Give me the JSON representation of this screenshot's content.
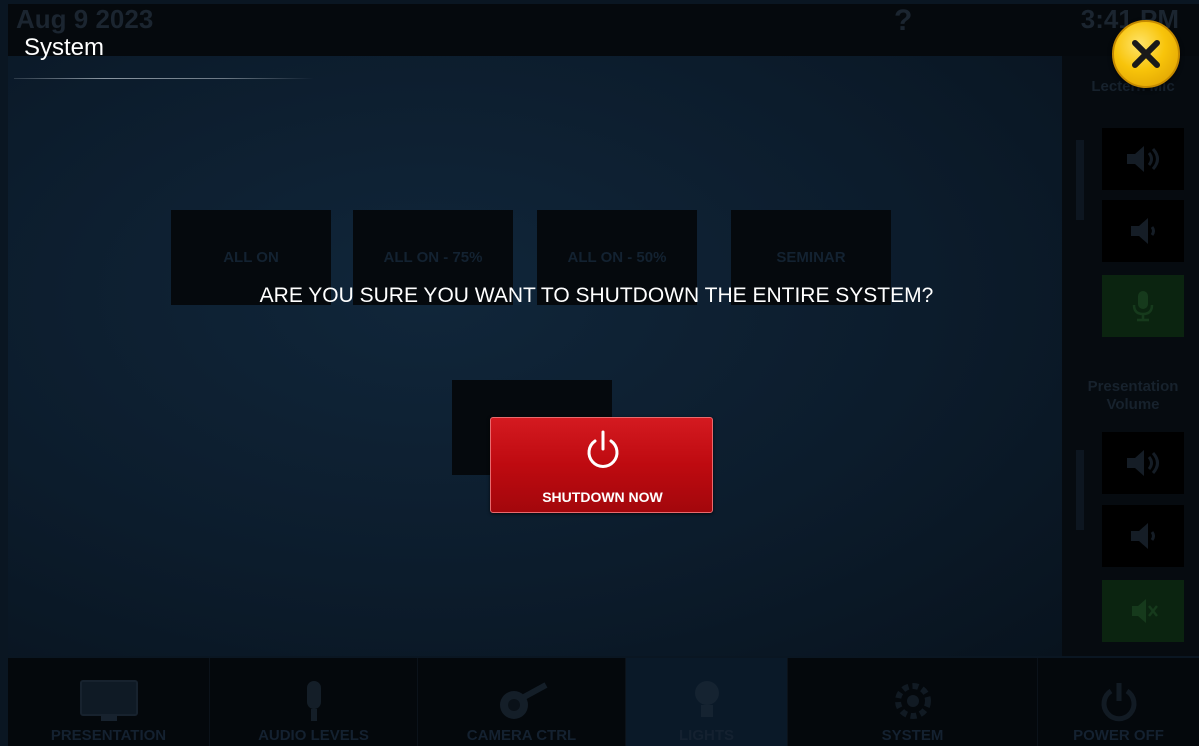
{
  "header": {
    "date": "Aug 9 2023",
    "time": "3:41 PM",
    "help_glyph": "?"
  },
  "modal": {
    "title": "System",
    "question": "ARE YOU SURE YOU WANT TO SHUTDOWN THE ENTIRE SYSTEM?",
    "shutdown_label": "SHUTDOWN NOW",
    "close_icon": "close-icon",
    "accent_yellow": "#f8c40a",
    "button_red": "#c40f15"
  },
  "presets": [
    "ALL ON",
    "ALL ON - 75%",
    "ALL ON - 50%",
    "SEMINAR"
  ],
  "right_panel": {
    "mic_label": "Lectern Mic",
    "presentation_label": "Presentation Volume"
  },
  "nav": [
    {
      "label": "PRESENTATION",
      "icon": "monitor-icon"
    },
    {
      "label": "AUDIO LEVELS",
      "icon": "microphone-icon"
    },
    {
      "label": "CAMERA CTRL",
      "icon": "camera-icon"
    },
    {
      "label": "LIGHTS",
      "icon": "lightbulb-icon"
    },
    {
      "label": "SYSTEM",
      "icon": "gear-icon"
    },
    {
      "label": "POWER OFF",
      "icon": "power-icon"
    }
  ]
}
